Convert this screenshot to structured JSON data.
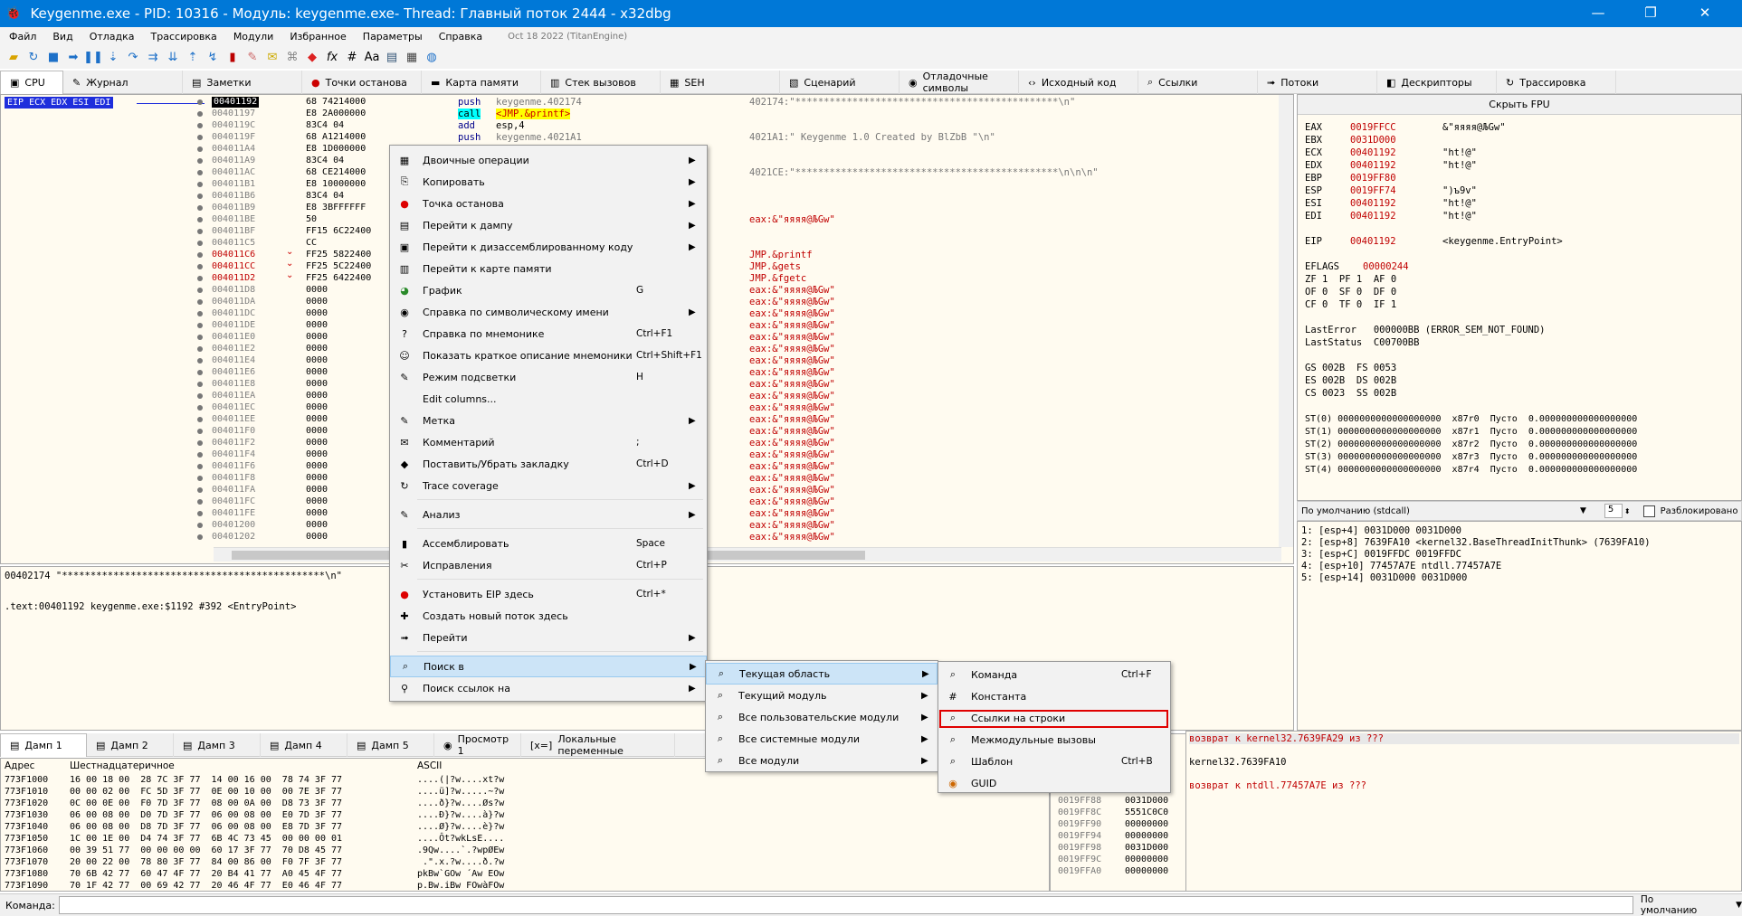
{
  "window": {
    "title": "Keygenme.exe - PID: 10316 - Модуль: keygenme.exe- Thread: Главный поток 2444 - x32dbg",
    "min": "—",
    "max": "❐",
    "close": "✕"
  },
  "menubar": {
    "items": [
      "Файл",
      "Вид",
      "Отладка",
      "Трассировка",
      "Модули",
      "Избранное",
      "Параметры",
      "Справка"
    ],
    "build": "Oct 18 2022 (TitanEngine)"
  },
  "tabs": [
    {
      "label": "CPU",
      "icon": "cpu-icon"
    },
    {
      "label": "Журнал",
      "icon": "log-icon"
    },
    {
      "label": "Заметки",
      "icon": "notes-icon"
    },
    {
      "label": "Точки останова",
      "icon": "breakpoint-icon"
    },
    {
      "label": "Карта памяти",
      "icon": "memory-map-icon"
    },
    {
      "label": "Стек вызовов",
      "icon": "call-stack-icon"
    },
    {
      "label": "SEH",
      "icon": "seh-icon"
    },
    {
      "label": "Сценарий",
      "icon": "script-icon"
    },
    {
      "label": "Отладочные символы",
      "icon": "symbols-icon"
    },
    {
      "label": "Исходный код",
      "icon": "source-icon"
    },
    {
      "label": "Ссылки",
      "icon": "references-icon"
    },
    {
      "label": "Потоки",
      "icon": "threads-icon"
    },
    {
      "label": "Дескрипторы",
      "icon": "handles-icon"
    },
    {
      "label": "Трассировка",
      "icon": "trace-icon"
    }
  ],
  "cpu": {
    "eip_label": "EIP ECX EDX ESI EDI",
    "rows": [
      {
        "addr": "00401192",
        "bytes": "68 74214000",
        "red": false,
        "sel": true
      },
      {
        "addr": "00401197",
        "bytes": "E8 2A000000"
      },
      {
        "addr": "0040119C",
        "bytes": "83C4 04"
      },
      {
        "addr": "0040119F",
        "bytes": "68 A1214000"
      },
      {
        "addr": "004011A4",
        "bytes": "E8 1D000000"
      },
      {
        "addr": "004011A9",
        "bytes": "83C4 04"
      },
      {
        "addr": "004011AC",
        "bytes": "68 CE214000"
      },
      {
        "addr": "004011B1",
        "bytes": "E8 10000000"
      },
      {
        "addr": "004011B6",
        "bytes": "83C4 04"
      },
      {
        "addr": "004011B9",
        "bytes": "E8 3BFFFFFF"
      },
      {
        "addr": "004011BE",
        "bytes": "50"
      },
      {
        "addr": "004011BF",
        "bytes": "FF15 6C22400"
      },
      {
        "addr": "004011C5",
        "bytes": "CC"
      },
      {
        "addr": "004011C6",
        "bytes": "FF25 5822400",
        "red": true
      },
      {
        "addr": "004011CC",
        "bytes": "FF25 5C22400",
        "red": true
      },
      {
        "addr": "004011D2",
        "bytes": "FF25 6422400",
        "red": true
      },
      {
        "addr": "004011D8",
        "bytes": "0000"
      },
      {
        "addr": "004011DA",
        "bytes": "0000"
      },
      {
        "addr": "004011DC",
        "bytes": "0000"
      },
      {
        "addr": "004011DE",
        "bytes": "0000"
      },
      {
        "addr": "004011E0",
        "bytes": "0000"
      },
      {
        "addr": "004011E2",
        "bytes": "0000"
      },
      {
        "addr": "004011E4",
        "bytes": "0000"
      },
      {
        "addr": "004011E6",
        "bytes": "0000"
      },
      {
        "addr": "004011E8",
        "bytes": "0000"
      },
      {
        "addr": "004011EA",
        "bytes": "0000"
      },
      {
        "addr": "004011EC",
        "bytes": "0000"
      },
      {
        "addr": "004011EE",
        "bytes": "0000"
      },
      {
        "addr": "004011F0",
        "bytes": "0000"
      },
      {
        "addr": "004011F2",
        "bytes": "0000"
      },
      {
        "addr": "004011F4",
        "bytes": "0000"
      },
      {
        "addr": "004011F6",
        "bytes": "0000"
      },
      {
        "addr": "004011F8",
        "bytes": "0000"
      },
      {
        "addr": "004011FA",
        "bytes": "0000"
      },
      {
        "addr": "004011FC",
        "bytes": "0000"
      },
      {
        "addr": "004011FE",
        "bytes": "0000"
      },
      {
        "addr": "00401200",
        "bytes": "0000"
      },
      {
        "addr": "00401202",
        "bytes": "0000"
      }
    ],
    "asm": [
      {
        "op": "push",
        "arg": "keygenme.402174"
      },
      {
        "op": "call",
        "arg": "<JMP.&printf>"
      },
      {
        "op": "add",
        "arg": "esp,4"
      },
      {
        "op": "push",
        "arg": "keygenme.4021A1"
      }
    ],
    "comments": [
      {
        "row": 0,
        "text": "402174:\"**********************************************\\n\""
      },
      {
        "row": 3,
        "text": "4021A1:\" Keygenme 1.0 Created by BlZbB          \"\\n\""
      },
      {
        "row": 6,
        "text": "4021CE:\"**********************************************\\n\\n\\n\""
      },
      {
        "row": 10,
        "text": "eax:&\"яяяя@ЉGw\""
      },
      {
        "row": 13,
        "text": "JMP.&printf"
      },
      {
        "row": 14,
        "text": "JMP.&gets"
      },
      {
        "row": 15,
        "text": "JMP.&fgetc"
      },
      {
        "row": 16,
        "text": "eax:&\"яяяя@ЉGw\""
      },
      {
        "row": 17,
        "text": "eax:&\"яяяя@ЉGw\""
      },
      {
        "row": 18,
        "text": "eax:&\"яяяя@ЉGw\""
      },
      {
        "row": 19,
        "text": "eax:&\"яяяя@ЉGw\""
      },
      {
        "row": 20,
        "text": "eax:&\"яяяя@ЉGw\""
      },
      {
        "row": 21,
        "text": "eax:&\"яяяя@ЉGw\""
      },
      {
        "row": 22,
        "text": "eax:&\"яяяя@ЉGw\""
      },
      {
        "row": 23,
        "text": "eax:&\"яяяя@ЉGw\""
      },
      {
        "row": 24,
        "text": "eax:&\"яяяя@ЉGw\""
      },
      {
        "row": 25,
        "text": "eax:&\"яяяя@ЉGw\""
      },
      {
        "row": 26,
        "text": "eax:&\"яяяя@ЉGw\""
      },
      {
        "row": 27,
        "text": "eax:&\"яяяя@ЉGw\""
      },
      {
        "row": 28,
        "text": "eax:&\"яяяя@ЉGw\""
      },
      {
        "row": 29,
        "text": "eax:&\"яяяя@ЉGw\""
      },
      {
        "row": 30,
        "text": "eax:&\"яяяя@ЉGw\""
      },
      {
        "row": 31,
        "text": "eax:&\"яяяя@ЉGw\""
      },
      {
        "row": 32,
        "text": "eax:&\"яяяя@ЉGw\""
      },
      {
        "row": 33,
        "text": "eax:&\"яяяя@ЉGw\""
      },
      {
        "row": 34,
        "text": "eax:&\"яяяя@ЉGw\""
      },
      {
        "row": 35,
        "text": "eax:&\"яяяя@ЉGw\""
      },
      {
        "row": 36,
        "text": "eax:&\"яяяя@ЉGw\""
      },
      {
        "row": 37,
        "text": "eax:&\"яяяя@ЉGw\""
      }
    ]
  },
  "info": {
    "line1": "00402174 \"**********************************************\\n\"",
    "line2": ".text:00401192 keygenme.exe:$1192 #392 <EntryPoint>"
  },
  "fpu": {
    "header": "Скрыть FPU",
    "regs": [
      {
        "n": "EAX",
        "v": "0019FFCC",
        "c": "&\"яяяя@ЉGw\""
      },
      {
        "n": "EBX",
        "v": "0031D000",
        "c": ""
      },
      {
        "n": "ECX",
        "v": "00401192",
        "c": "\"ht!@\""
      },
      {
        "n": "EDX",
        "v": "00401192",
        "c": "\"ht!@\""
      },
      {
        "n": "EBP",
        "v": "0019FF80",
        "c": ""
      },
      {
        "n": "ESP",
        "v": "0019FF74",
        "c": "\")ъ9v\""
      },
      {
        "n": "ESI",
        "v": "00401192",
        "c": "\"ht!@\""
      },
      {
        "n": "EDI",
        "v": "00401192",
        "c": "\"ht!@\""
      }
    ],
    "eip": {
      "n": "EIP",
      "v": "00401192",
      "c": "<keygenme.EntryPoint>"
    },
    "eflags": {
      "n": "EFLAGS",
      "v": "00000244"
    },
    "flags": [
      "ZF 1  PF 1  AF 0",
      "OF 0  SF 0  DF 0",
      "CF 0  TF 0  IF 1"
    ],
    "lasterror": "LastError   000000BB (ERROR_SEM_NOT_FOUND)",
    "laststatus": "LastStatus  C00700BB",
    "segs": [
      "GS 002B  FS 0053",
      "ES 002B  DS 002B",
      "CS 0023  SS 002B"
    ],
    "st": [
      "ST(0) 0000000000000000000  x87r0  Пусто  0.000000000000000000",
      "ST(1) 0000000000000000000  x87r1  Пусто  0.000000000000000000",
      "ST(2) 0000000000000000000  x87r2  Пусто  0.000000000000000000",
      "ST(3) 0000000000000000000  x87r3  Пусто  0.000000000000000000",
      "ST(4) 0000000000000000000  x87r4  Пусто  0.000000000000000000"
    ]
  },
  "callconv": {
    "value": "По умолчанию (stdcall)",
    "count": "5",
    "unlocked": "Разблокировано"
  },
  "stackargs": [
    "1: [esp+4] 0031D000 0031D000",
    "2: [esp+8] 7639FA10 <kernel32.BaseThreadInitThunk> (7639FA10)",
    "3: [esp+C] 0019FFDC 0019FFDC",
    "4: [esp+10] 77457A7E ntdll.77457A7E",
    "5: [esp+14] 0031D000 0031D000"
  ],
  "dumptabs": [
    {
      "label": "Дамп 1",
      "icon": "dump-icon"
    },
    {
      "label": "Дамп 2",
      "icon": "dump-icon"
    },
    {
      "label": "Дамп 3",
      "icon": "dump-icon"
    },
    {
      "label": "Дамп 4",
      "icon": "dump-icon"
    },
    {
      "label": "Дамп 5",
      "icon": "dump-icon"
    },
    {
      "label": "Просмотр 1",
      "icon": "watch-icon"
    },
    {
      "label": "Локальные переменные",
      "icon": "locals-icon"
    }
  ],
  "dump": {
    "h_addr": "Адрес",
    "h_hex": "Шестнадцатеричное",
    "h_ascii": "ASCII",
    "rows": [
      {
        "a": "773F1000",
        "h": "16 00 18 00  28 7C 3F 77  14 00 16 00  78 74 3F 77",
        "s": "....(|?w....xt?w"
      },
      {
        "a": "773F1010",
        "h": "00 00 02 00  FC 5D 3F 77  0E 00 10 00  00 7E 3F 77",
        "s": "....ü]?w.....~?w"
      },
      {
        "a": "773F1020",
        "h": "0C 00 0E 00  F0 7D 3F 77  08 00 0A 00  D8 73 3F 77",
        "s": "....ð}?w....Øs?w"
      },
      {
        "a": "773F1030",
        "h": "06 00 08 00  D0 7D 3F 77  06 00 08 00  E0 7D 3F 77",
        "s": "....Ð}?w....à}?w"
      },
      {
        "a": "773F1040",
        "h": "06 00 08 00  D8 7D 3F 77  06 00 08 00  E8 7D 3F 77",
        "s": "....Ø}?w....è}?w"
      },
      {
        "a": "773F1050",
        "h": "1C 00 1E 00  D4 74 3F 77  6B 4C 73 45  00 00 00 01",
        "s": "....Ôt?wkLsE...."
      },
      {
        "a": "773F1060",
        "h": "00 39 51 77  00 00 00 00  60 17 3F 77  70 D8 45 77",
        "s": ".9Qw....`.?wpØEw"
      },
      {
        "a": "773F1070",
        "h": "20 00 22 00  78 80 3F 77  84 00 86 00  F0 7F 3F 77",
        "s": " .\".x.?w....ð.?w"
      },
      {
        "a": "773F1080",
        "h": "70 6B 42 77  60 47 4F 77  20 B4 41 77  A0 45 4F 77",
        "s": "pkBw`GOw ´Aw EOw"
      },
      {
        "a": "773F1090",
        "h": "70 1F 42 77  00 69 42 77  20 46 4F 77  E0 46 4F 77",
        "s": "p.Bw.iBw FOwàFOw"
      }
    ]
  },
  "stackpane": {
    "rows": [
      {
        "a": "0019FF88",
        "v": "0031D000"
      },
      {
        "a": "0019FF8C",
        "v": "5551C0C0"
      },
      {
        "a": "0019FF90",
        "v": "00000000"
      },
      {
        "a": "0019FF94",
        "v": "00000000"
      },
      {
        "a": "0019FF98",
        "v": "0031D000"
      },
      {
        "a": "0019FF9C",
        "v": "00000000"
      },
      {
        "a": "0019FFA0",
        "v": "00000000"
      }
    ]
  },
  "calls": {
    "l1": "возврат к kernel32.7639FA29 из ???",
    "l2": "kernel32.7639FA10",
    "l3": "возврат к ntdll.77457A7E из ???"
  },
  "cmd": {
    "label": "Команда:",
    "mode": "По умолчанию"
  },
  "ctxmenu": {
    "items": [
      {
        "label": "Двоичные операции",
        "key": "",
        "arrow": true,
        "icon": "binary-icon"
      },
      {
        "label": "Копировать",
        "key": "",
        "arrow": true,
        "icon": "copy-icon"
      },
      {
        "label": "Точка останова",
        "key": "",
        "arrow": true,
        "icon": "breakpoint-dot-icon"
      },
      {
        "label": "Перейти к дампу",
        "key": "",
        "arrow": true,
        "icon": "dump-goto-icon"
      },
      {
        "label": "Перейти к дизассемблированному коду",
        "key": "",
        "arrow": true,
        "icon": "disasm-goto-icon"
      },
      {
        "label": "Перейти к карте памяти",
        "key": "",
        "arrow": false,
        "icon": "memmap-goto-icon"
      },
      {
        "label": "График",
        "key": "G",
        "arrow": false,
        "icon": "graph-icon"
      },
      {
        "label": "Справка по символическому имени",
        "key": "",
        "arrow": true,
        "icon": "help-icon"
      },
      {
        "label": "Справка по мнемонике",
        "key": "Ctrl+F1",
        "arrow": false,
        "icon": "mnemonic-help-icon"
      },
      {
        "label": "Показать краткое описание мнемоники",
        "key": "Ctrl+Shift+F1",
        "arrow": false,
        "icon": "mnemonic-brief-icon"
      },
      {
        "label": "Режим подсветки",
        "key": "H",
        "arrow": false,
        "icon": "highlight-icon"
      },
      {
        "label": "Edit columns...",
        "key": "",
        "arrow": false,
        "icon": ""
      },
      {
        "label": "Метка",
        "key": "",
        "arrow": true,
        "icon": "label-icon"
      },
      {
        "label": "Комментарий",
        "key": ";",
        "arrow": false,
        "icon": "comment-icon"
      },
      {
        "label": "Поставить/Убрать закладку",
        "key": "Ctrl+D",
        "arrow": false,
        "icon": "bookmark-icon"
      },
      {
        "label": "Trace coverage",
        "key": "",
        "arrow": true,
        "icon": "trace-coverage-icon"
      },
      {
        "label": "Анализ",
        "key": "",
        "arrow": true,
        "icon": "analysis-icon"
      },
      {
        "label": "Ассемблировать",
        "key": "Space",
        "arrow": false,
        "icon": "assemble-icon"
      },
      {
        "label": "Исправления",
        "key": "Ctrl+P",
        "arrow": false,
        "icon": "patch-icon"
      },
      {
        "label": "Установить EIP здесь",
        "key": "Ctrl+*",
        "arrow": false,
        "icon": "set-eip-icon"
      },
      {
        "label": "Создать новый поток здесь",
        "key": "",
        "arrow": false,
        "icon": "new-thread-icon"
      },
      {
        "label": "Перейти",
        "key": "",
        "arrow": true,
        "icon": "goto-icon"
      },
      {
        "label": "Поиск в",
        "key": "",
        "arrow": true,
        "icon": "search-icon"
      },
      {
        "label": "Поиск ссылок на",
        "key": "",
        "arrow": true,
        "icon": "find-refs-icon"
      }
    ]
  },
  "submenu1": {
    "items": [
      {
        "label": "Текущая область",
        "arrow": true,
        "icon": "region-icon"
      },
      {
        "label": "Текущий модуль",
        "arrow": true,
        "icon": "module-icon"
      },
      {
        "label": "Все пользовательские модули",
        "arrow": true,
        "icon": "user-modules-icon"
      },
      {
        "label": "Все системные модули",
        "arrow": true,
        "icon": "system-modules-icon"
      },
      {
        "label": "Все модули",
        "arrow": true,
        "icon": "all-modules-icon"
      }
    ]
  },
  "submenu2": {
    "items": [
      {
        "label": "Команда",
        "key": "Ctrl+F",
        "icon": "command-search-icon"
      },
      {
        "label": "Константа",
        "key": "",
        "icon": "constant-icon"
      },
      {
        "label": "Ссылки на строки",
        "key": "",
        "icon": "string-refs-icon"
      },
      {
        "label": "Межмодульные вызовы",
        "key": "",
        "icon": "intermodular-icon"
      },
      {
        "label": "Шаблон",
        "key": "Ctrl+B",
        "icon": "pattern-icon"
      },
      {
        "label": "GUID",
        "key": "",
        "icon": "guid-icon"
      }
    ]
  }
}
